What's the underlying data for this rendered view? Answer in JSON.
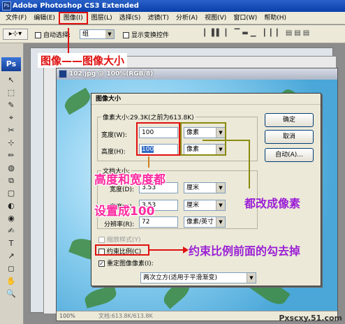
{
  "app": {
    "title": "Adobe Photoshop CS3 Extended",
    "logo": "Ps"
  },
  "menu": [
    "文件(F)",
    "编辑(E)",
    "图像(I)",
    "图层(L)",
    "选择(S)",
    "滤镜(T)",
    "分析(A)",
    "视图(V)",
    "窗口(W)",
    "帮助(H)"
  ],
  "optbar": {
    "auto_select": "自动选择:",
    "group": "组",
    "show_transform": "显示变换控件"
  },
  "tools": [
    "↖",
    "⬚",
    "✎",
    "⌖",
    "✂",
    "⊹",
    "✏",
    "◍",
    "⧉",
    "▢",
    "◐",
    "◉",
    "✍",
    "T",
    "↗",
    "◻",
    "✋",
    "🔍"
  ],
  "doc": {
    "title": "102.jpg @ 100%(RGB/8)",
    "zoom": "100%",
    "info": "文档:613.8K/613.8K"
  },
  "dialog": {
    "title": "图像大小",
    "pixel_dims": "像素大小:29.3K(之前为613.8K)",
    "width_label": "宽度(W):",
    "width_value": "100",
    "width_unit": "像素",
    "height_label": "高度(H):",
    "height_value": "100",
    "height_unit": "像素",
    "doc_size": "文档大小:",
    "doc_width_label": "宽度(D):",
    "doc_width_value": "3.53",
    "doc_width_unit": "厘米",
    "doc_height_label": "高度(G):",
    "doc_height_value": "3.53",
    "doc_height_unit": "厘米",
    "resolution_label": "分辨率(R):",
    "resolution_value": "72",
    "resolution_unit": "像素/英寸",
    "scale_styles": "缩放样式(Y)",
    "constrain": "约束比例(C)",
    "resample": "重定图像像素(I):",
    "resample_method": "两次立方(适用于平滑渐变)",
    "ok": "确定",
    "cancel": "取消",
    "auto": "自动(A)..."
  },
  "annotations": {
    "menu_hint": "图像——图像大小",
    "left_hint_1": "高度和宽度都",
    "left_hint_2": "设置成100",
    "right_hint": "都改成像素",
    "constrain_hint": "约束比例前面的勾去掉"
  },
  "watermark": "Pxscxy.51.com"
}
